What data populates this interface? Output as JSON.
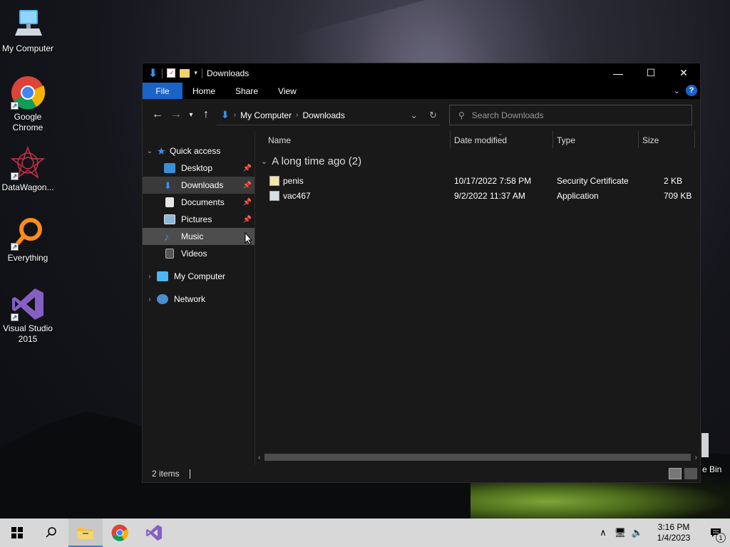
{
  "desktop": {
    "icons": [
      {
        "label": "My Computer",
        "icon": "computer-icon"
      },
      {
        "label": "Google Chrome",
        "icon": "chrome-icon"
      },
      {
        "label": "DataWagon...",
        "icon": "datawagon-icon"
      },
      {
        "label": "Everything",
        "icon": "everything-icon"
      },
      {
        "label": "Visual Studio 2015",
        "icon": "visual-studio-icon"
      }
    ],
    "recycle_bin_label": "e Bin"
  },
  "window": {
    "title": "Downloads",
    "ribbon_tabs": [
      "File",
      "Home",
      "Share",
      "View"
    ],
    "breadcrumb": [
      "My Computer",
      "Downloads"
    ],
    "search_placeholder": "Search Downloads",
    "columns": [
      "Name",
      "Date modified",
      "Type",
      "Size"
    ],
    "group": {
      "label": "A long time ago (2)"
    },
    "files": [
      {
        "name": "penis",
        "date": "10/17/2022 7:58 PM",
        "type": "Security Certificate",
        "size": "2 KB",
        "icon": "certificate-icon"
      },
      {
        "name": "vac467",
        "date": "9/2/2022 11:37 AM",
        "type": "Application",
        "size": "709 KB",
        "icon": "application-icon"
      }
    ],
    "nav": {
      "quick_access": "Quick access",
      "items": [
        {
          "label": "Desktop",
          "icon": "desktop-folder-icon",
          "pinned": true
        },
        {
          "label": "Downloads",
          "icon": "downloads-folder-icon",
          "pinned": true
        },
        {
          "label": "Documents",
          "icon": "documents-folder-icon",
          "pinned": true
        },
        {
          "label": "Pictures",
          "icon": "pictures-folder-icon",
          "pinned": true
        },
        {
          "label": "Music",
          "icon": "music-folder-icon",
          "pinned": false
        },
        {
          "label": "Videos",
          "icon": "videos-folder-icon",
          "pinned": false
        }
      ],
      "my_computer": "My Computer",
      "network": "Network"
    },
    "status": {
      "items_count": "2 items"
    }
  },
  "taskbar": {
    "time": "3:16 PM",
    "date": "1/4/2023",
    "notification_count": "1"
  },
  "colors": {
    "accent": "#1a63c8",
    "window_bg": "#191919",
    "taskbar_bg": "#d8d8d8"
  }
}
